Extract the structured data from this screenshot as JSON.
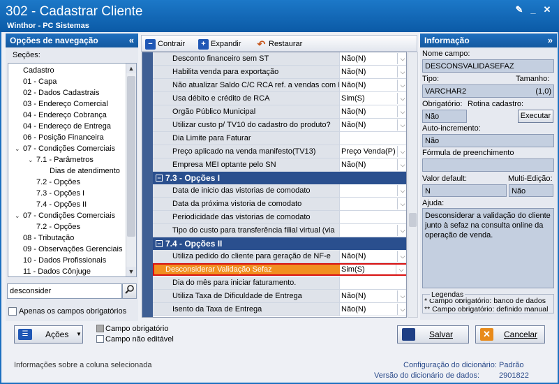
{
  "window": {
    "title": "302 - Cadastrar Cliente",
    "subtitle": "Winthor - PC Sistemas"
  },
  "nav": {
    "header": "Opções de navegação",
    "sections_label": "Seções:",
    "items": [
      "Cadastro",
      "01 - Capa",
      "02 - Dados Cadastrais",
      "03 - Endereço Comercial",
      "04 - Endereço Cobrança",
      "04 - Endereço de Entrega",
      "06 - Posição Financeira",
      "07 - Condições Comerciais",
      "7.1 - Parâmetros",
      "Dias de atendimento",
      "7.2 - Opções",
      "7.3 - Opções I",
      "7.4 - Opções II",
      "07 - Condições Comerciais",
      "7.2 - Opções",
      "08 - Tributação",
      "09 - Observações Gerenciais",
      "10 - Dados Profissionais",
      "11 - Dados Cônjuge"
    ],
    "search_value": "desconsider",
    "required_only_label": "Apenas os campos obrigatórios"
  },
  "toolbar": {
    "collapse": "Contrair",
    "expand": "Expandir",
    "restore": "Restaurar"
  },
  "grid": {
    "rows_a": [
      {
        "label": "Desconto financeiro sem ST",
        "value": "Não(N)"
      },
      {
        "label": "Habilita venda para exportação",
        "value": "Não(N)"
      },
      {
        "label": "Não atualizar Saldo C/C RCA ref. a vendas com D",
        "value": "Não(N)"
      },
      {
        "label": "Usa débito e crédito de RCA",
        "value": "Sim(S)"
      },
      {
        "label": "Orgão Público Municipal",
        "value": "Não(N)"
      },
      {
        "label": "Utilizar custo p/ TV10 do cadastro do produto?",
        "value": "Não(N)"
      },
      {
        "label": "Dia Limite para Faturar",
        "value": ""
      },
      {
        "label": "Preço aplicado na venda manifesto(TV13)",
        "value": "Preço Venda(P)"
      },
      {
        "label": "Empresa MEI optante pelo SN",
        "value": "Não(N)"
      }
    ],
    "section_b": "7.3 - Opções I",
    "rows_b": [
      {
        "label": "Data de inicio das vistorias de comodato",
        "value": ""
      },
      {
        "label": "Data da próxima vistoria de comodato",
        "value": ""
      },
      {
        "label": "Periodicidade das vistorias de comodato",
        "value": ""
      },
      {
        "label": "Tipo do custo  para transferência  filial virtual (via",
        "value": ""
      }
    ],
    "section_c": "7.4 - Opções II",
    "rows_c": [
      {
        "label": "Utiliza pedido do cliente para geração de NF-e",
        "value": "Não(N)"
      },
      {
        "label": "Desconsiderar Validação Sefaz",
        "value": "Sim(S)"
      },
      {
        "label": "Dia do mês para iniciar faturamento.",
        "value": ""
      },
      {
        "label": "Utiliza Taxa de Dificuldade de Entrega",
        "value": "Não(N)"
      },
      {
        "label": "Isento da Taxa de Entrega",
        "value": "Não(N)"
      }
    ]
  },
  "info": {
    "header": "Informação",
    "field_name_label": "Nome campo:",
    "field_name": "DESCONSVALIDASEFAZ",
    "type_label": "Tipo:",
    "size_label": "Tamanho:",
    "type": "VARCHAR2",
    "size": "(1,0)",
    "required_label": "Obrigatório:",
    "routine_label": "Rotina cadastro:",
    "required": "Não",
    "execute_label": "Executar",
    "autoinc_label": "Auto-incremento:",
    "autoinc": "Não",
    "formula_label": "Fórmula de preenchimento",
    "default_label": "Valor default:",
    "multi_label": "Multi-Edição:",
    "default": "N",
    "multi": "Não",
    "help_label": "Ajuda:",
    "help_text": "Desconsiderar a validação do cliente junto à sefaz na consulta online da operação de venda.",
    "legend_title": "Legendas",
    "legend1": "* Campo obrigatório: banco de dados",
    "legend2": "** Campo obrigatório: definido manual"
  },
  "bottom": {
    "actions": "Ações",
    "legend_required": "Campo obrigatório",
    "legend_readonly": "Campo não editável",
    "save": "Salvar",
    "cancel": "Cancelar"
  },
  "status": {
    "left": "Informações sobre a coluna selecionada",
    "dict_config_label": "Configuração do dicionário:",
    "dict_config": "Padrão",
    "dict_version_label": "Versão do dicionário de dados:",
    "dict_version": "2901822"
  }
}
